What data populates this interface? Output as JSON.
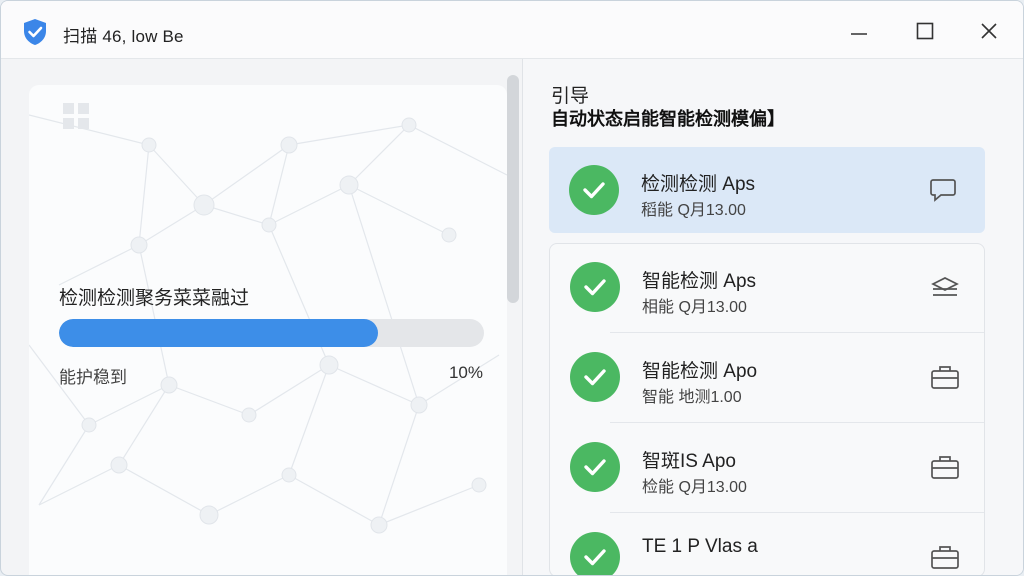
{
  "window": {
    "title": "扫描 46, low Be"
  },
  "titlebar_buttons": {
    "minimize": "minimize",
    "maximize": "maximize",
    "close": "close"
  },
  "left": {
    "task_label": "检测检测聚务菜菜融过",
    "status_label": "能护稳到",
    "percent_label": "10%",
    "progress": 0.75
  },
  "guide": {
    "heading": "引导",
    "subheading": "自动状态启能智能检测模偏】"
  },
  "items": [
    {
      "name": "检测检测 Aps",
      "meta": "稻能 Q月13.00",
      "icon": "chat-bubble-icon",
      "selected": true
    },
    {
      "name": "智能检测 Aps",
      "meta": "相能 Q月13.00",
      "icon": "layers-icon",
      "selected": false
    },
    {
      "name": "智能检测 Apo",
      "meta": "智能 地测1.00",
      "icon": "briefcase-icon",
      "selected": false
    },
    {
      "name": "智斑IS Apo",
      "meta": "检能 Q月13.00",
      "icon": "briefcase-icon",
      "selected": false
    },
    {
      "name": "TE 1 P Vlas a",
      "meta": "",
      "icon": "briefcase-icon",
      "selected": false
    }
  ],
  "colors": {
    "accent": "#3d8ee8",
    "check_green": "#4bb862",
    "selected_bg": "#dbe8f7",
    "shield_blue": "#3b86e8"
  }
}
